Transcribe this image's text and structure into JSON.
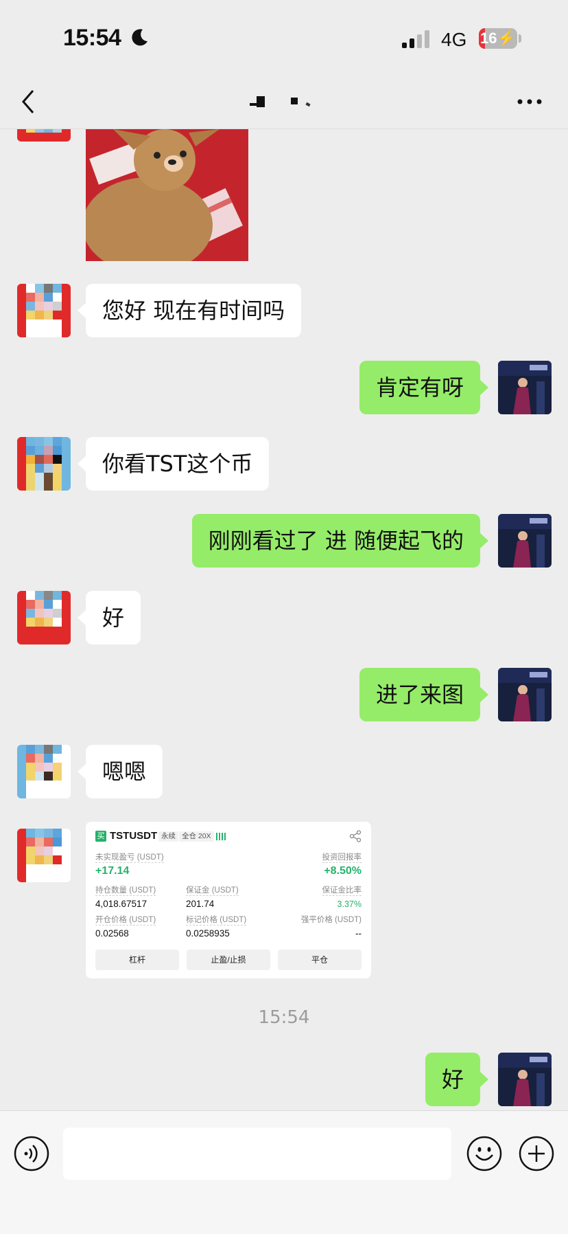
{
  "status_bar": {
    "time": "15:54",
    "network": "4G",
    "battery_level": "16",
    "battery_fraction": 0.16,
    "moon_icon": "moon-icon",
    "signal_icon": "signal-icon",
    "battery_icon": "battery-charging-icon"
  },
  "header": {
    "back_icon": "chevron-left-icon",
    "contact_name": "",
    "more_icon": "more-dots-icon"
  },
  "messages": [
    {
      "side": "in",
      "type": "image",
      "description_icon": "image-icon"
    },
    {
      "side": "in",
      "type": "text",
      "text": "您好 现在有时间吗"
    },
    {
      "side": "out",
      "type": "text",
      "text": "肯定有呀"
    },
    {
      "side": "in",
      "type": "text",
      "text": "你看TST这个币"
    },
    {
      "side": "out",
      "type": "text",
      "text": "刚刚看过了 进 随便起飞的"
    },
    {
      "side": "in",
      "type": "text",
      "text": "好"
    },
    {
      "side": "out",
      "type": "text",
      "text": "进了来图"
    },
    {
      "side": "in",
      "type": "text",
      "text": "嗯嗯"
    },
    {
      "side": "in",
      "type": "card"
    },
    {
      "side": "out",
      "type": "text",
      "text": "好"
    }
  ],
  "timestamp": "15:54",
  "trade_card": {
    "badge": "买",
    "symbol": "TSTUSDT",
    "contract_type": "永续",
    "margin_mode": "全仓 20X",
    "share_icon": "share-icon",
    "unrealized_pnl_label": "未实现盈亏 (USDT)",
    "unrealized_pnl": "+17.14",
    "roi_label": "投资回报率",
    "roi": "+8.50%",
    "position_size_label": "持仓数量 (USDT)",
    "position_size": "4,018.67517",
    "margin_label": "保证金 (USDT)",
    "margin": "201.74",
    "margin_ratio_label": "保证金比率",
    "margin_ratio": "3.37%",
    "entry_price_label": "开仓价格 (USDT)",
    "entry_price": "0.02568",
    "mark_price_label": "标记价格 (USDT)",
    "mark_price": "0.0258935",
    "liq_price_label": "强平价格 (USDT)",
    "liq_price": "--",
    "buttons": [
      "杠杆",
      "止盈/止损",
      "平仓"
    ]
  },
  "input_bar": {
    "voice_icon": "voice-icon",
    "input_value": "",
    "emoji_icon": "emoji-icon",
    "plus_icon": "plus-icon"
  },
  "colors": {
    "background": "#ededed",
    "bubble_out": "#95ec69",
    "bubble_in": "#ffffff",
    "profit_green": "#24b36b",
    "battery_red": "#e5343a"
  }
}
